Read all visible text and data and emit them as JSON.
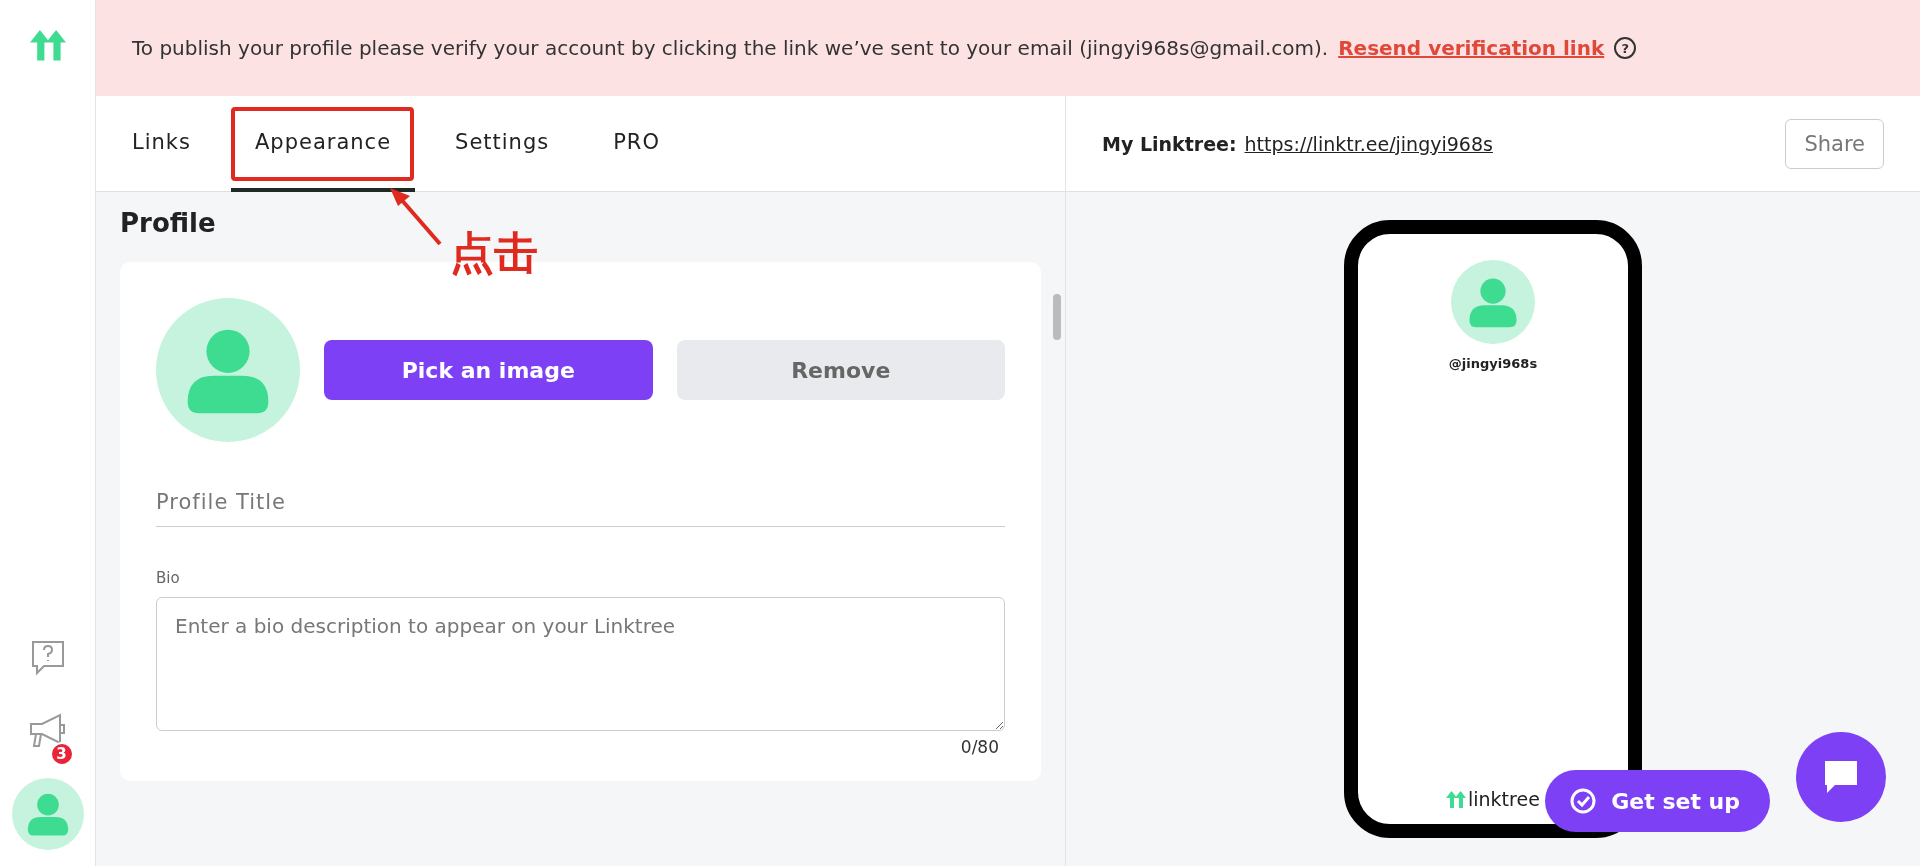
{
  "banner": {
    "message": "To publish your profile please verify your account by clicking the link we’ve sent to your email (jingyi968s@gmail.com).",
    "link": "Resend verification link",
    "help": "?"
  },
  "sidebar": {
    "notifications_badge": "3"
  },
  "tabs": [
    {
      "label": "Links",
      "selected": false
    },
    {
      "label": "Appearance",
      "selected": true
    },
    {
      "label": "Settings",
      "selected": false
    },
    {
      "label": "PRO",
      "selected": false
    }
  ],
  "annotation": {
    "text": "点击"
  },
  "header": {
    "label": "My Linktree:",
    "url": "https://linktr.ee/jingyi968s",
    "share": "Share"
  },
  "profile": {
    "heading": "Profile",
    "pick_button": "Pick an image",
    "remove_button": "Remove",
    "title_placeholder": "Profile Title",
    "bio_label": "Bio",
    "bio_placeholder": "Enter a bio description to appear on your Linktree",
    "bio_counter": "0/80"
  },
  "preview": {
    "username": "@jingyi968s",
    "brand": "linktree",
    "setup_button": "Get set up"
  }
}
